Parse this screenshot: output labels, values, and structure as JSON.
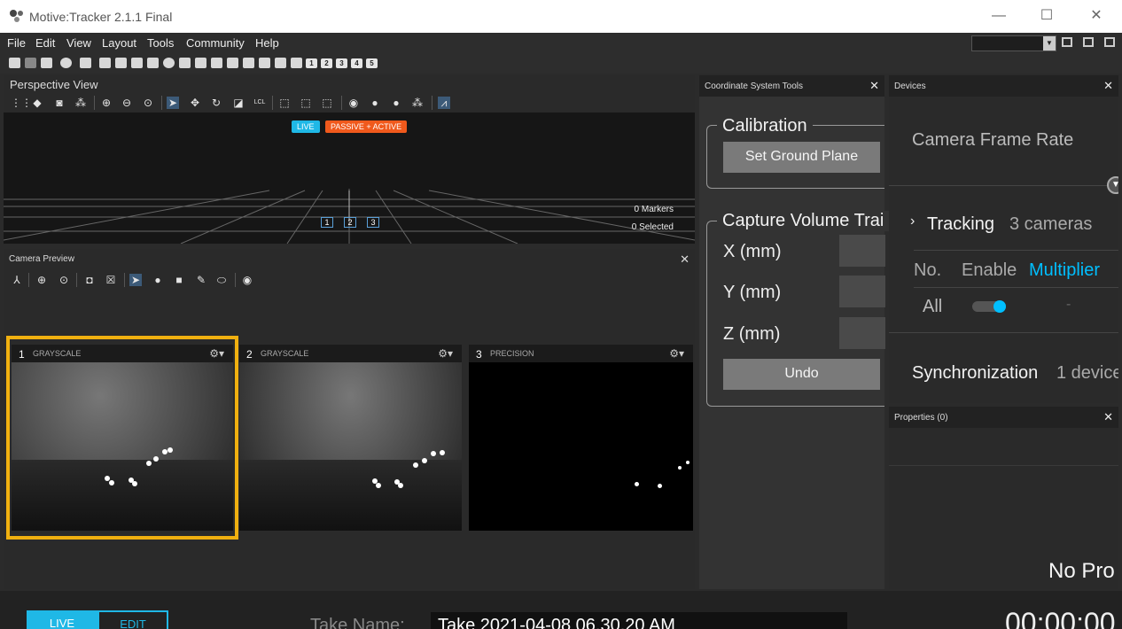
{
  "window": {
    "title": "Motive:Tracker 2.1.1 Final",
    "minimize": "—",
    "maximize": "☐",
    "close": "✕"
  },
  "menu": [
    "File",
    "Edit",
    "View",
    "Layout",
    "Tools",
    "Community",
    "Help"
  ],
  "toolbar": {
    "numbers": [
      "1",
      "2",
      "3",
      "4",
      "5"
    ]
  },
  "perspective": {
    "title": "Perspective View",
    "badge_live": "LIVE",
    "badge_mode": "PASSIVE + ACTIVE",
    "markers": "0 Markers",
    "selected": "0 Selected",
    "lcl": "LCL",
    "cams": [
      "1",
      "2",
      "3"
    ]
  },
  "camera_preview": {
    "title": "Camera Preview",
    "close": "✕",
    "cameras": [
      {
        "num": "1",
        "mode": "GRAYSCALE"
      },
      {
        "num": "2",
        "mode": "GRAYSCALE"
      },
      {
        "num": "3",
        "mode": "PRECISION"
      }
    ]
  },
  "coord": {
    "title": "Coordinate System Tools",
    "close": "✕",
    "calibration": "Calibration",
    "set_ground": "Set Ground Plane",
    "capture_volume": "Capture Volume Trai",
    "x": "X (mm)",
    "y": "Y (mm)",
    "z": "Z (mm)",
    "undo": "Undo"
  },
  "devices": {
    "title": "Devices",
    "close": "✕",
    "frame_rate": "Camera Frame Rate",
    "tracking": "Tracking",
    "tracking_count": "3 cameras",
    "col_no": "No.",
    "col_enable": "Enable",
    "col_mult": "Multiplier",
    "row_all": "All",
    "row_dash": "-",
    "sync": "Synchronization",
    "sync_count": "1 device"
  },
  "properties": {
    "title": "Properties (0)",
    "close": "✕",
    "no_prop": "No Pro"
  },
  "bottom": {
    "live": "LIVE",
    "edit": "EDIT",
    "take_label": "Take Name:",
    "take_value": "Take 2021-04-08 06.30.20 AM",
    "time": "00:00:00"
  },
  "colors": {
    "accent": "#00bfff",
    "live_badge": "#1fb8e6",
    "mode_badge": "#f0591c",
    "highlight": "#f0b010"
  }
}
